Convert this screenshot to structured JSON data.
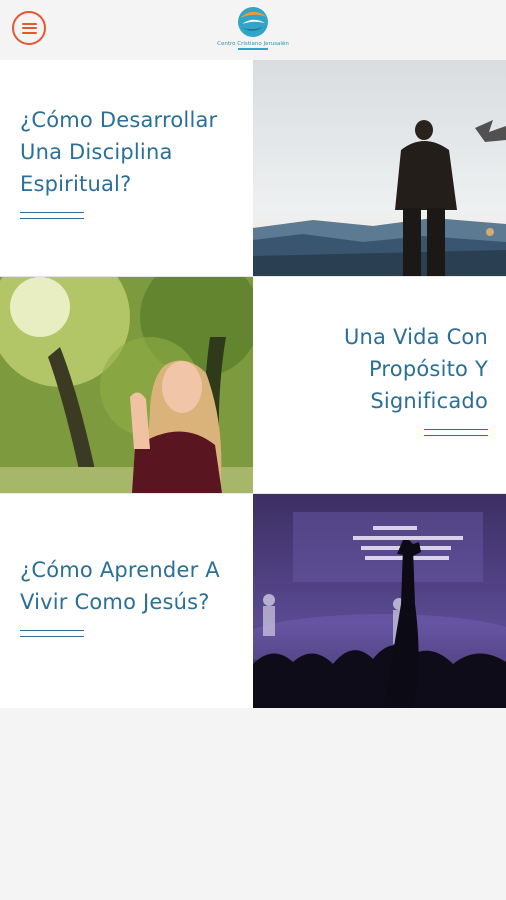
{
  "header": {
    "menu_icon": "hamburger-menu-icon",
    "logo_text": "Centro Cristiano Jerusalén"
  },
  "cards": [
    {
      "title": "¿Cómo Desarrollar Una Disciplina Espiritual?",
      "image": "man-standing-on-mountain-at-sunset"
    },
    {
      "title": "Una Vida Con Propósito Y Significado",
      "image": "woman-praying-in-forest"
    },
    {
      "title": "¿Cómo Aprender A Vivir Como Jesús?",
      "image": "worship-concert-with-raised-hand"
    }
  ],
  "colors": {
    "accent": "#e8552f",
    "title": "#2a6f97",
    "background": "#f4f4f4"
  }
}
